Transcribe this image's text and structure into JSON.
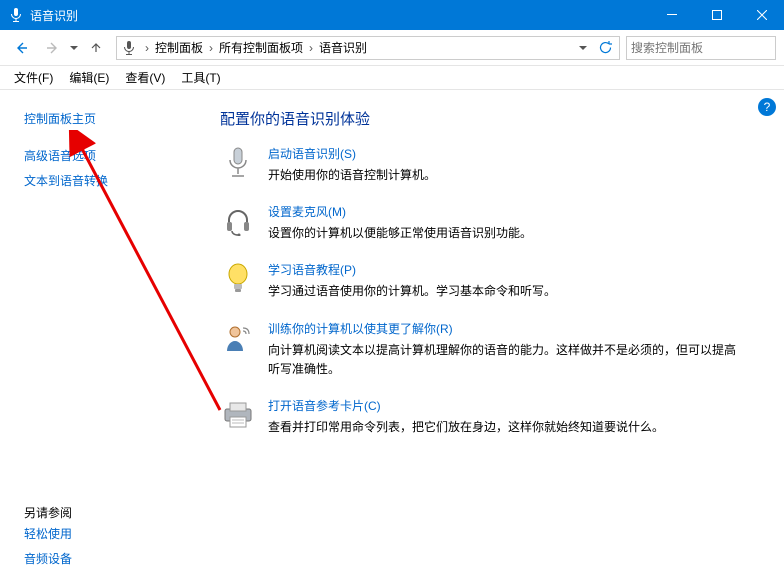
{
  "window": {
    "title": "语音识别"
  },
  "address": {
    "seg1": "控制面板",
    "seg2": "所有控制面板项",
    "seg3": "语音识别"
  },
  "search": {
    "placeholder": "搜索控制面板"
  },
  "menu": {
    "file": "文件(F)",
    "edit": "编辑(E)",
    "view": "查看(V)",
    "tools": "工具(T)"
  },
  "sidebar": {
    "home": "控制面板主页",
    "advanced": "高级语音选项",
    "tts": "文本到语音转换",
    "see_also_title": "另请参阅",
    "ease": "轻松使用",
    "audio": "音频设备"
  },
  "content": {
    "heading": "配置你的语音识别体验",
    "opt1": {
      "link": "启动语音识别(S)",
      "desc": "开始使用你的语音控制计算机。"
    },
    "opt2": {
      "link": "设置麦克风(M)",
      "desc": "设置你的计算机以便能够正常使用语音识别功能。"
    },
    "opt3": {
      "link": "学习语音教程(P)",
      "desc": "学习通过语音使用你的计算机。学习基本命令和听写。"
    },
    "opt4": {
      "link": "训练你的计算机以使其更了解你(R)",
      "desc": "向计算机阅读文本以提高计算机理解你的语音的能力。这样做并不是必须的，但可以提高听写准确性。"
    },
    "opt5": {
      "link": "打开语音参考卡片(C)",
      "desc": "查看并打印常用命令列表，把它们放在身边，这样你就始终知道要说什么。"
    }
  }
}
